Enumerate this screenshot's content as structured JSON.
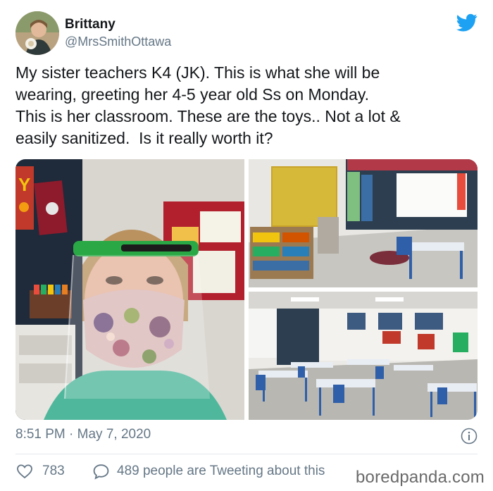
{
  "user": {
    "display_name": "Brittany",
    "handle": "@MrsSmithOttawa"
  },
  "tweet": {
    "text": "My sister teachers K4 (JK). This is what she will be\nwearing, greeting her 4-5 year old Ss on Monday.\nThis is her classroom. These are the toys.. Not a lot &\neasily sanitized.  Is it really worth it?"
  },
  "photos": [
    {
      "subject": "teacher wearing face shield and floral mask"
    },
    {
      "subject": "classroom corner with shelves of toys"
    },
    {
      "subject": "classroom with separated desks"
    }
  ],
  "footer": {
    "timestamp": "8:51 PM · May 7, 2020",
    "likes": "783",
    "replies_text": "489 people are Tweeting about this"
  },
  "watermark": "boredpanda.com",
  "colors": {
    "twitter_blue": "#1da1f2",
    "secondary_text": "#657786",
    "primary_text": "#14171a"
  },
  "icons": {
    "brand": "twitter-bird-icon",
    "info": "info-icon",
    "like": "heart-icon",
    "reply": "speech-bubble-icon"
  }
}
